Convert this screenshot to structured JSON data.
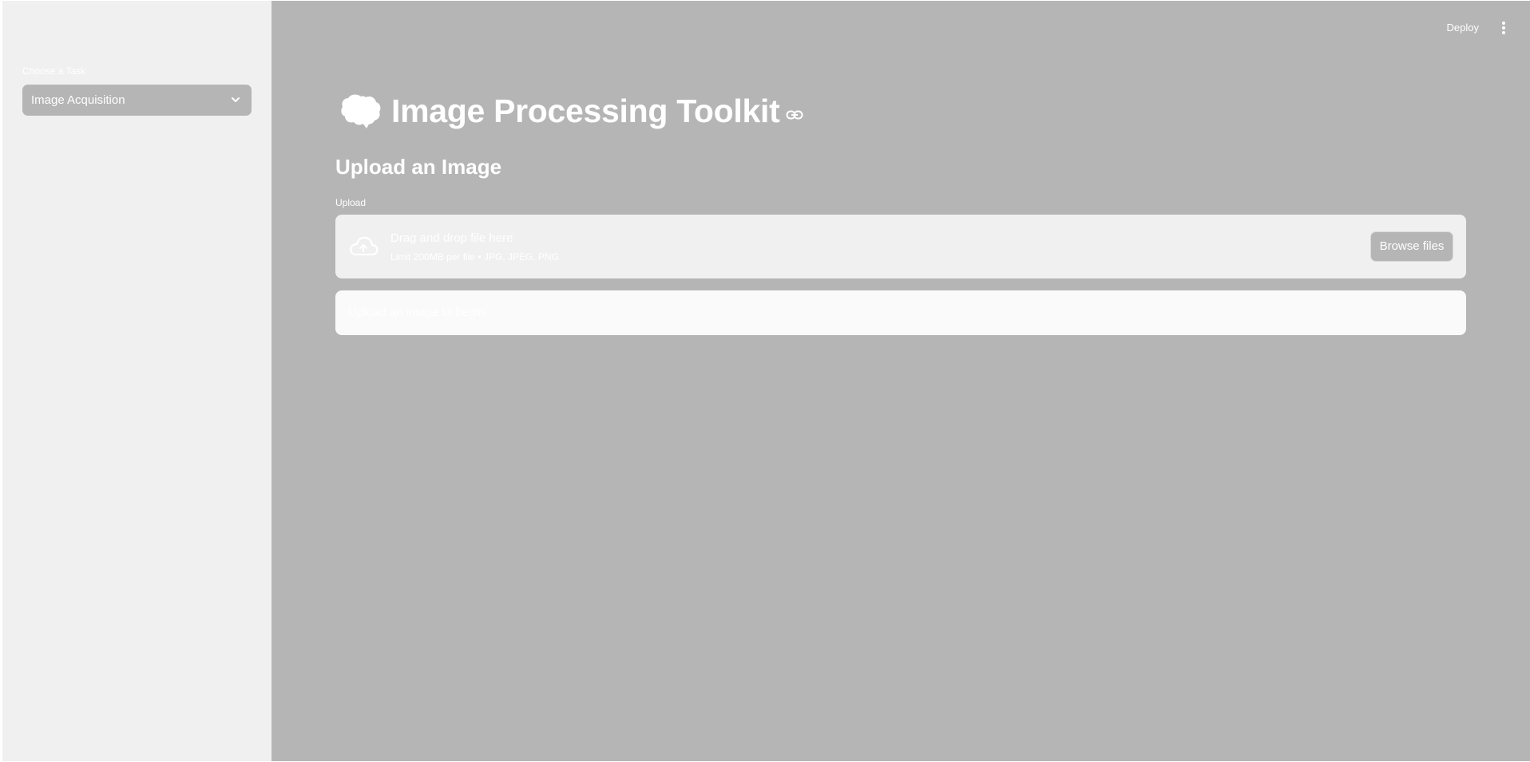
{
  "sidebar": {
    "task_label": "Choose a Task",
    "task_select": {
      "value": "Image Acquisition",
      "icon": "chevron-down-icon"
    }
  },
  "header": {
    "deploy_label": "Deploy",
    "menu_icon": "kebab-menu-icon"
  },
  "main": {
    "title": "Image Processing Toolkit",
    "title_icon": "brain-icon",
    "subheader": "Upload an Image",
    "uploader": {
      "label": "Upload",
      "drop_title": "Drag and drop file here",
      "limit_text": "Limit 200MB per file • JPG, JPEG, PNG",
      "browse_label": "Browse files",
      "icon": "cloud-upload-icon"
    },
    "info_message": "Upload an image to begin."
  },
  "colors": {
    "sidebar_bg": "#f0f0f0",
    "main_bg": "#b5b5b5",
    "text": "#ffffff",
    "info_bg": "#fafafa"
  }
}
